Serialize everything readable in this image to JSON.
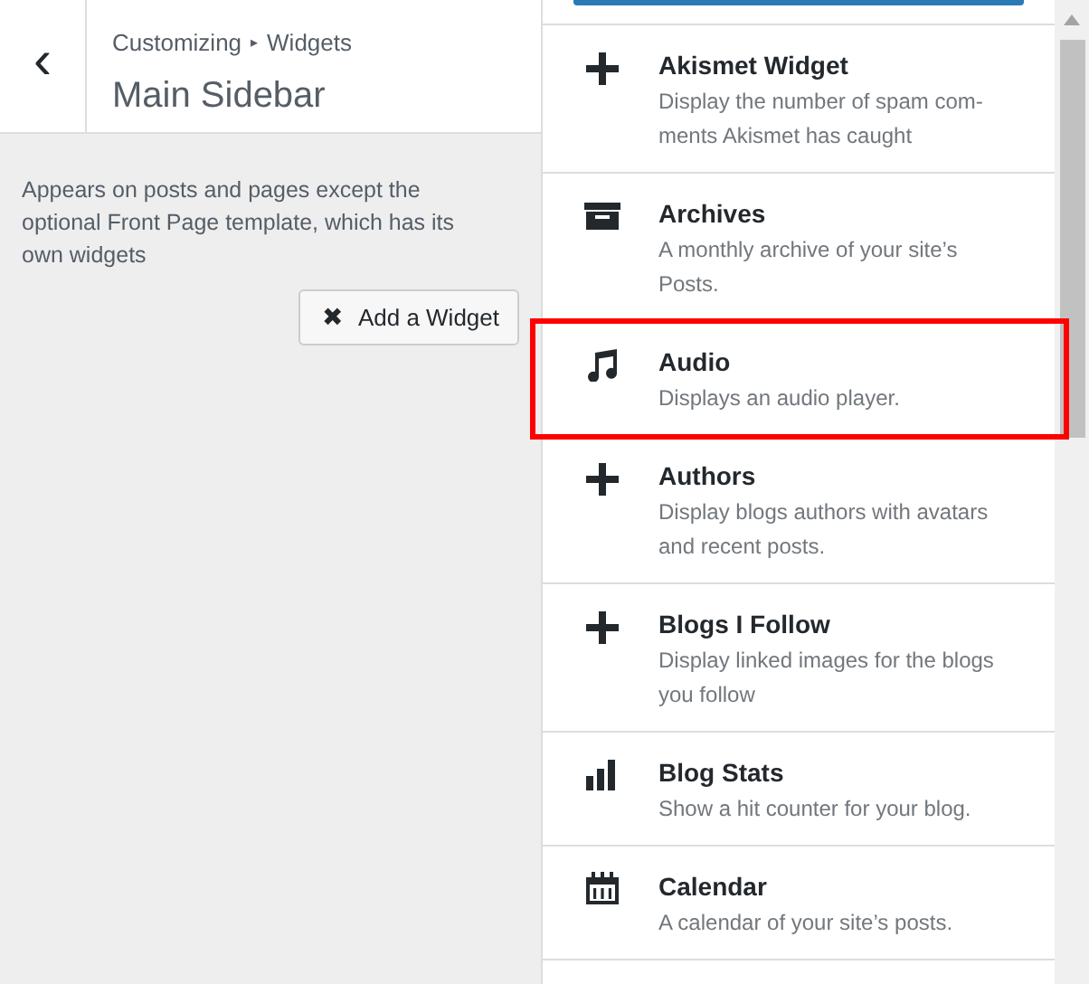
{
  "header": {
    "back": "‹",
    "breadcrumb": "Customizing",
    "breadcrumb_separator": "▸",
    "breadcrumb_current": "Widgets",
    "title": "Main Sidebar"
  },
  "description": "Appears on posts and pages except the optional Front Page template, which has its own widgets",
  "add_button": {
    "icon": "✖",
    "label": "Add a Widget"
  },
  "widgets": [
    {
      "kind": "plus",
      "name": "Akismet Widget",
      "description": "Display the number of spam com-ments Akismet has caught",
      "highlighted": false
    },
    {
      "kind": "archive",
      "name": "Archives",
      "description": "A monthly archive of your site’s Posts.",
      "highlighted": false
    },
    {
      "kind": "music",
      "name": "Audio",
      "description": "Displays an audio player.",
      "highlighted": true
    },
    {
      "kind": "plus",
      "name": "Authors",
      "description": "Display blogs authors with avatars and recent posts.",
      "highlighted": false
    },
    {
      "kind": "plus",
      "name": "Blogs I Follow",
      "description": "Display linked images for the blogs you follow",
      "highlighted": false
    },
    {
      "kind": "chart",
      "name": "Blog Stats",
      "description": "Show a hit counter for your blog.",
      "highlighted": false
    },
    {
      "kind": "calendar",
      "name": "Calendar",
      "description": "A calendar of your site’s posts.",
      "highlighted": false
    }
  ]
}
